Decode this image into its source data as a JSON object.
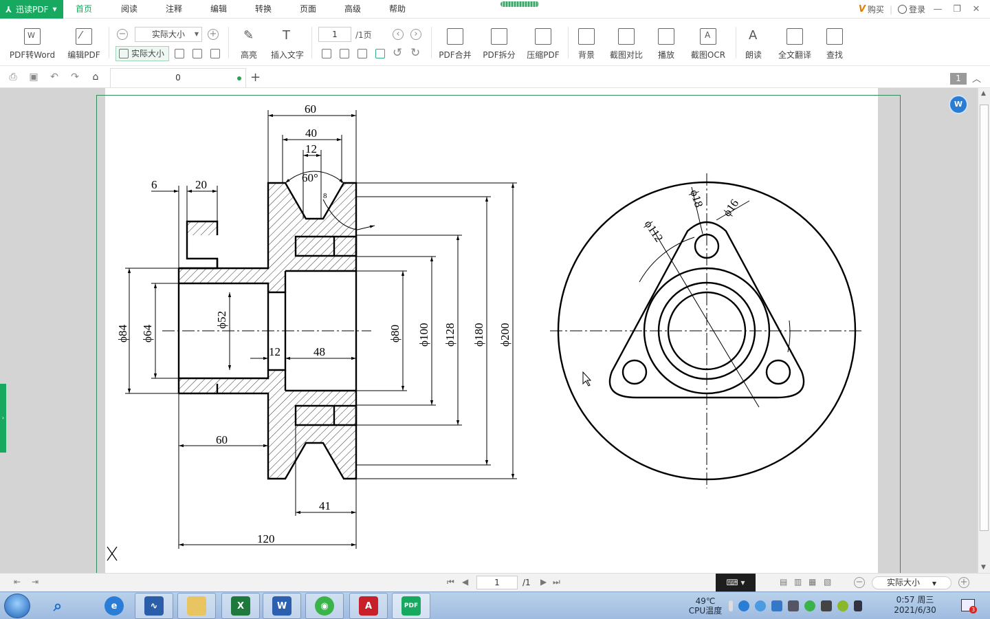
{
  "app": {
    "brand": "迅读PDF",
    "menu": [
      "首页",
      "阅读",
      "注释",
      "编辑",
      "转换",
      "页面",
      "高级",
      "帮助"
    ],
    "active_menu_index": 0,
    "buy_label": "购买",
    "login_label": "登录"
  },
  "ribbon": {
    "pdf_to_word": "PDF转Word",
    "edit_pdf": "编辑PDF",
    "zoom_value": "实际大小",
    "actual_size": "实际大小",
    "highlight": "高亮",
    "insert_text": "插入文字",
    "page_current": "1",
    "page_total": "/1页",
    "merge": "PDF合并",
    "split": "PDF拆分",
    "compress": "压缩PDF",
    "background": "背景",
    "compare": "截图对比",
    "play": "播放",
    "ocr": "截图OCR",
    "read_aloud": "朗读",
    "translate": "全文翻译",
    "find": "查找"
  },
  "quickbar": {
    "doc_tab": "0",
    "page_badge": "1"
  },
  "drawing": {
    "dims": {
      "d60_top": "60",
      "d40": "40",
      "d12_top": "12",
      "angle60": "60°",
      "r8": "8",
      "d6": "6",
      "d20": "20",
      "phi84": "ϕ84",
      "phi64": "ϕ64",
      "phi52": "ϕ52",
      "d12_mid": "12",
      "d48": "48",
      "phi80": "ϕ80",
      "phi100": "ϕ100",
      "phi128": "ϕ128",
      "phi180": "ϕ180",
      "phi200": "ϕ200",
      "d60_bottom": "60",
      "d41": "41",
      "d120": "120",
      "phi18": "ϕ18",
      "phi16": "ϕ16",
      "phi112": "ϕ112"
    }
  },
  "statusbar": {
    "page": "1",
    "total": "/1",
    "zoom": "实际大小"
  },
  "taskbar": {
    "cpu_temp": "49℃",
    "cpu_label": "CPU温度",
    "time": "0:57 周三",
    "date": "2021/6/30",
    "notif_count": "3"
  },
  "colors": {
    "brand_green": "#17a95f",
    "page_frame": "#2f8a5c"
  }
}
